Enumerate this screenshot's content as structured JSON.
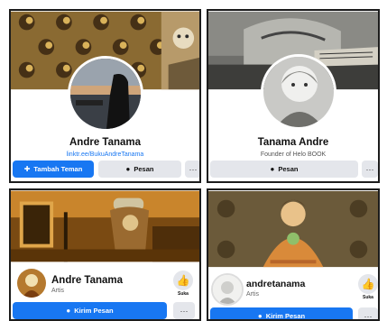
{
  "cards": [
    {
      "name": "Andre Tanama",
      "subtitle": "linktr.ee/BukuAndreTanama",
      "primary_button": "Tambah Teman",
      "secondary_button": "Pesan",
      "more": "···"
    },
    {
      "name": "Tanama Andre",
      "subtitle": "Founder of Helo BOOK",
      "primary_button": "Pesan",
      "more": "···"
    },
    {
      "name": "Andre Tanama",
      "category": "Artis",
      "like_label": "Suka",
      "primary_button": "Kirim Pesan",
      "more": "···"
    },
    {
      "name": "andretanama",
      "category": "Artis",
      "like_label": "Suka",
      "primary_button": "Kirim Pesan",
      "more": "···"
    }
  ],
  "colors": {
    "accent": "#1877f2",
    "button_gray": "#e4e6eb",
    "link": "#1877f2"
  },
  "icons": [
    "add-friend-icon",
    "messenger-icon",
    "thumbs-up-icon",
    "more-icon"
  ]
}
